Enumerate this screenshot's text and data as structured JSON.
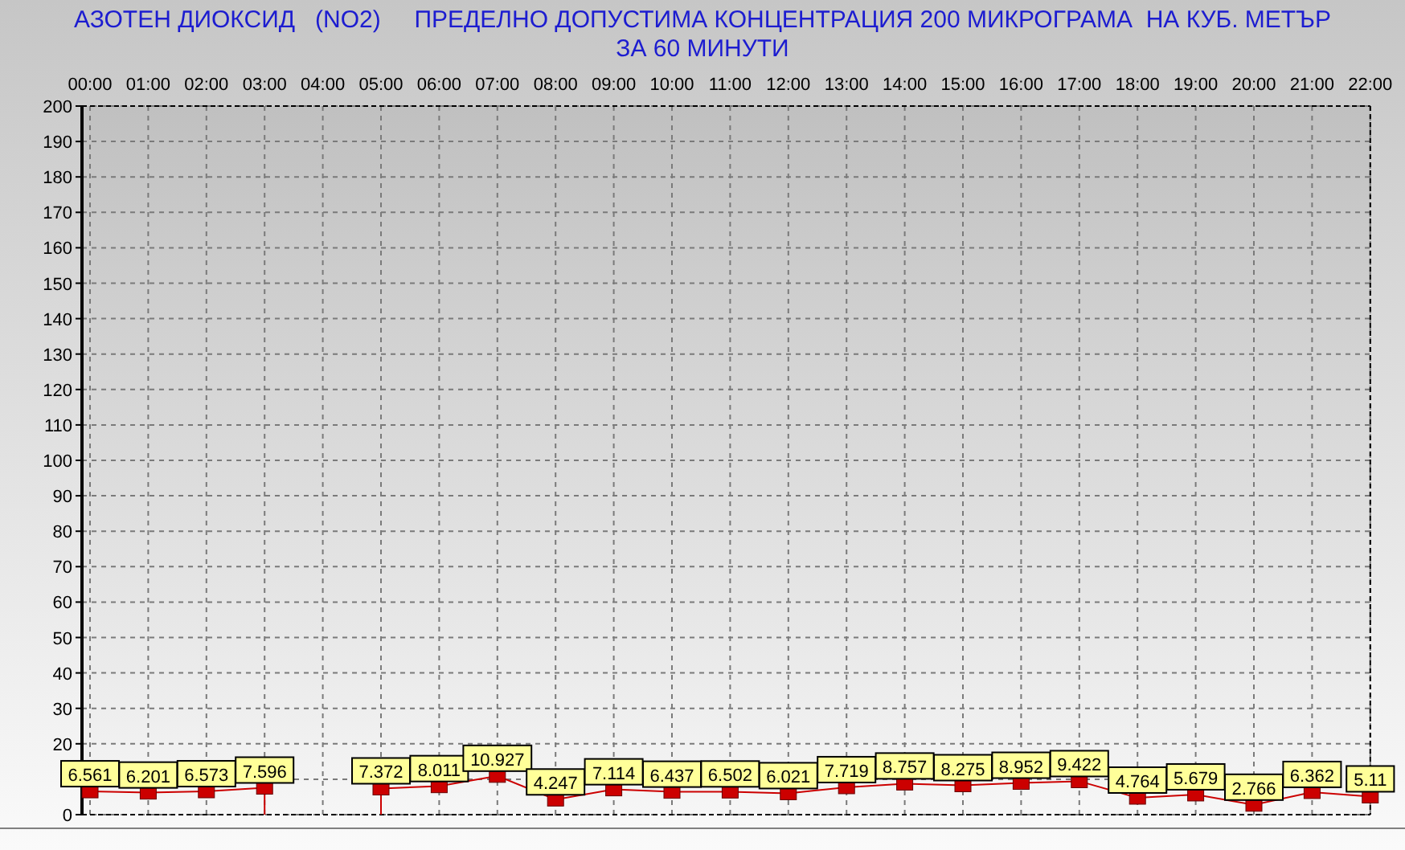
{
  "title": "АЗОТЕН ДИОКСИД   (NO2)     ПРЕДЕЛНО ДОПУСТИМА КОНЦЕНТРАЦИЯ 200 МИКРОГРАМА  НА КУБ. МЕТЪР ЗА 60 МИНУТИ",
  "chart_data": {
    "type": "line",
    "categories": [
      "00:00",
      "01:00",
      "02:00",
      "03:00",
      "04:00",
      "05:00",
      "06:00",
      "07:00",
      "08:00",
      "09:00",
      "10:00",
      "11:00",
      "12:00",
      "13:00",
      "14:00",
      "15:00",
      "16:00",
      "17:00",
      "18:00",
      "19:00",
      "20:00",
      "21:00",
      "22:00"
    ],
    "series": [
      {
        "color": "#cc0000",
        "marker": "square",
        "values": [
          6.561,
          6.201,
          6.573,
          7.596,
          null,
          7.372,
          8.011,
          10.927,
          4.247,
          7.114,
          6.437,
          6.502,
          6.021,
          7.719,
          8.757,
          8.275,
          8.952,
          9.422,
          4.764,
          5.679,
          2.766,
          6.362,
          5.11
        ]
      }
    ],
    "ylim": [
      0,
      200
    ],
    "yticks": [
      0,
      20,
      30,
      40,
      50,
      60,
      70,
      80,
      90,
      100,
      110,
      120,
      130,
      140,
      150,
      160,
      170,
      180,
      190,
      200
    ],
    "grid": true,
    "data_labels": true
  }
}
